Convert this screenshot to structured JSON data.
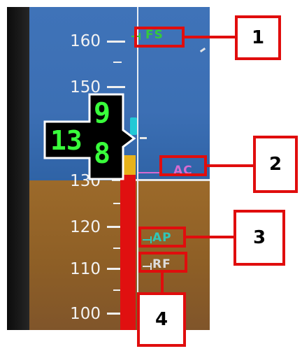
{
  "pfd": {
    "airspeed_scale": {
      "ticks": [
        "160",
        "150",
        "130",
        "120",
        "110",
        "100"
      ]
    },
    "current_speed": {
      "tens": "13",
      "upper_units": "9",
      "lower_units": "8"
    },
    "speed_bugs": [
      {
        "label": "FS",
        "color": "#35c93a"
      },
      {
        "label": "AC",
        "color": "#d76bd0"
      },
      {
        "label": "AP",
        "color": "#2fc7b8"
      },
      {
        "label": "RF",
        "color": "#dcdcdc"
      }
    ]
  },
  "callouts": [
    "1",
    "2",
    "3",
    "4"
  ],
  "colors": {
    "callout_red": "#e00d0d",
    "sky": "#3f73b8",
    "ground": "#9c6a2a",
    "speed_digits": "#39ff3b",
    "trend_red": "#e01010",
    "trend_yellow": "#e7b21a",
    "trend_cyan": "#22c9d6"
  }
}
